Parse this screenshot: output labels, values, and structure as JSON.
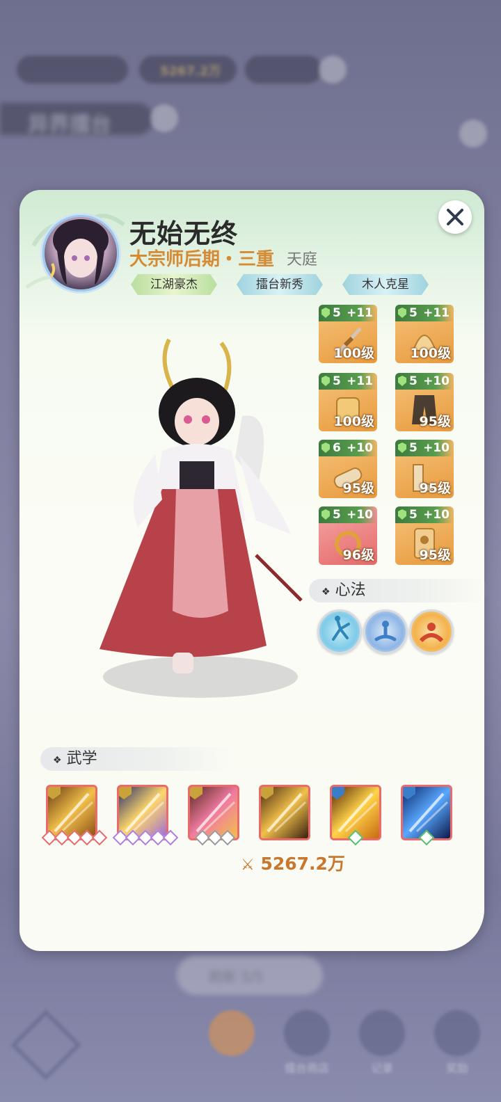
{
  "header_blurred": {
    "currency1": "5267.2万",
    "title": "异界擂台"
  },
  "bottom_blurred": {
    "pill": "刷新 5/5",
    "nav": [
      "",
      "擂台商店",
      "记录",
      "奖励"
    ]
  },
  "profile": {
    "name": "无始无终",
    "rank": "大宗师后期・三重",
    "realm": "天庭",
    "tags": [
      "江湖豪杰",
      "擂台新秀",
      "木人克星"
    ]
  },
  "equipment": [
    {
      "stars": "5",
      "plus": "+11",
      "level": "100级",
      "art": "sword"
    },
    {
      "stars": "5",
      "plus": "+11",
      "level": "100级",
      "art": "helmet"
    },
    {
      "stars": "5",
      "plus": "+11",
      "level": "100级",
      "art": "armor"
    },
    {
      "stars": "5",
      "plus": "+10",
      "level": "95级",
      "art": "pants"
    },
    {
      "stars": "6",
      "plus": "+10",
      "level": "95级",
      "art": "bracer"
    },
    {
      "stars": "5",
      "plus": "+10",
      "level": "95级",
      "art": "boots"
    },
    {
      "stars": "5",
      "plus": "+10",
      "level": "96级",
      "art": "ring"
    },
    {
      "stars": "5",
      "plus": "+10",
      "level": "95级",
      "art": "token"
    }
  ],
  "mind_section": {
    "label": "心法",
    "items": [
      "kick-icon",
      "meditate-icon",
      "fire-monk-icon"
    ]
  },
  "martial_section": {
    "label": "武学"
  },
  "skills": [
    {
      "icon": "sword-rain-icon",
      "type": "gold",
      "pips": 5,
      "pip_color": "#e96b6b"
    },
    {
      "icon": "rainbow-slash-icon",
      "type": "gold",
      "pips": 5,
      "pip_color": "#b07ee0"
    },
    {
      "icon": "pink-blade-icon",
      "type": "gold",
      "pips": 3,
      "pip_color": "#9a9a9a"
    },
    {
      "icon": "sword-dance-icon",
      "type": "gold",
      "pips": 0,
      "pip_color": "#9a9a9a"
    },
    {
      "icon": "golden-dragon-icon",
      "type": "blue",
      "pips": 1,
      "pip_color": "#56c06a"
    },
    {
      "icon": "ice-crystal-icon",
      "type": "blue",
      "pips": 1,
      "pip_color": "#56c06a"
    }
  ],
  "power": "5267.2万",
  "colors": {
    "accent": "#d58a34",
    "equip_gold": "#f0b060",
    "equip_red": "#e46a6a",
    "badge_green": "#3d7a3f"
  }
}
